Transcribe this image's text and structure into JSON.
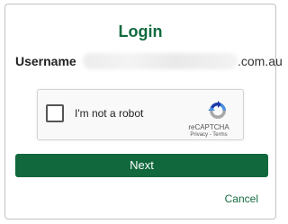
{
  "login": {
    "title": "Login",
    "username_label": "Username",
    "username_value_suffix": ".com.au"
  },
  "captcha": {
    "label": "I'm not a robot",
    "brand": "reCAPTCHA",
    "privacy_link": "Privacy",
    "separator": " - ",
    "terms_link": "Terms",
    "logo_icon": "recaptcha-logo-icon"
  },
  "actions": {
    "next_label": "Next",
    "cancel_label": "Cancel"
  },
  "colors": {
    "brand_green": "#106b3e",
    "frame_border": "#bfc4c0",
    "recaptcha_blue": "#4a90e2",
    "recaptcha_dark": "#1c3aa9",
    "recaptcha_grey": "#a9a9a9"
  }
}
